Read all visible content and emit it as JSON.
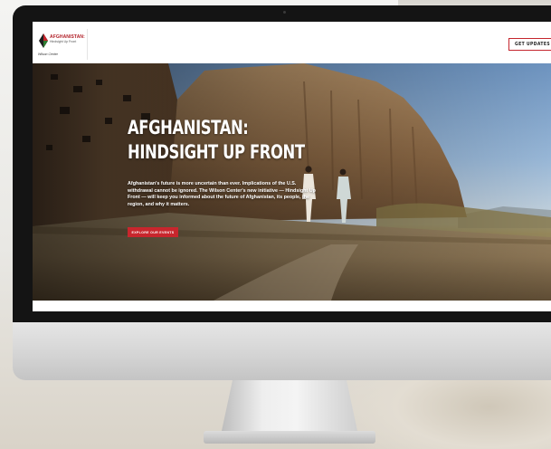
{
  "site": {
    "logo_title": "AFGHANISTAN:",
    "logo_subtitle": "Hindsight Up Front",
    "org_name": "Wilson Center",
    "updates_button": "GET UPDATES"
  },
  "hero": {
    "title_line1": "AFGHANISTAN:",
    "title_line2": "HINDSIGHT UP FRONT",
    "description": "Afghanistan's future is more uncertain than ever. Implications of the U.S. withdrawal cannot be ignored. The Wilson Center's new initiative — Hindsight Up Front — will keep you informed about the future of Afghanistan, its people, the region, and why it matters.",
    "cta_label": "EXPLORE OUR EVENTS"
  },
  "colors": {
    "accent_red": "#c8262d",
    "bezel": "#141414"
  }
}
